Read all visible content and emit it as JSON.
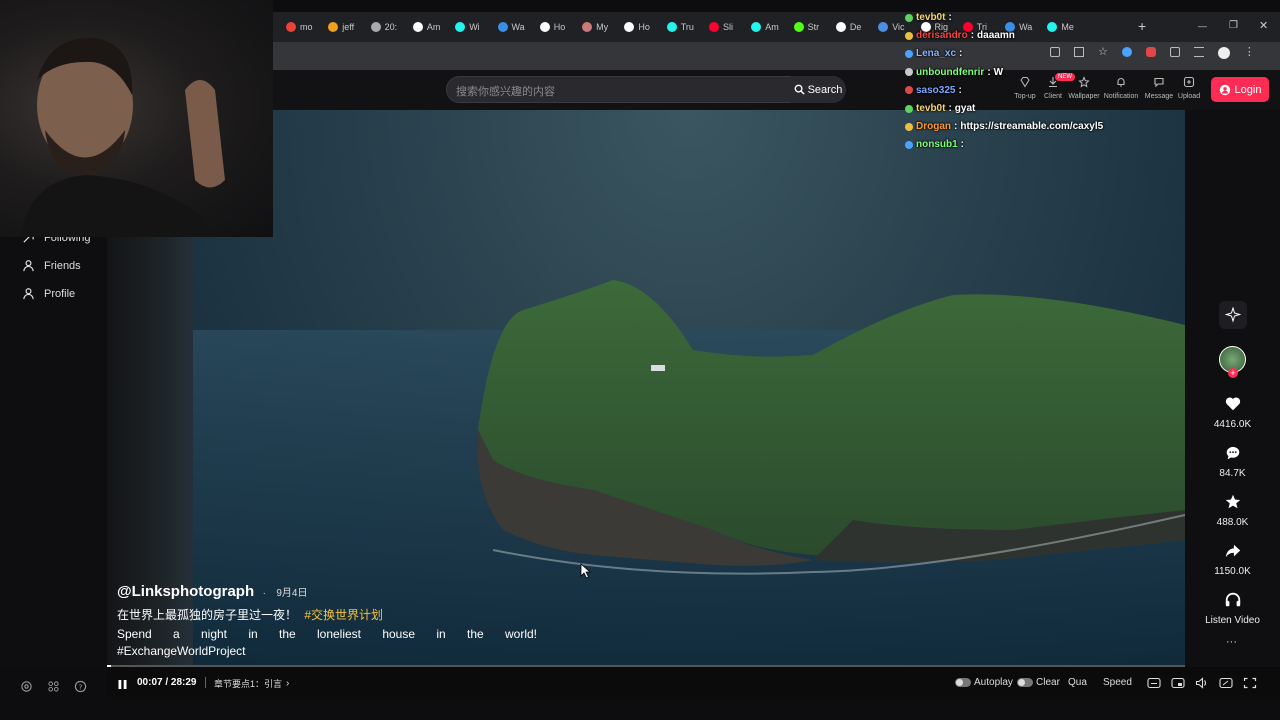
{
  "browser": {
    "tabs": [
      {
        "label": "mo",
        "color": "#ea4335"
      },
      {
        "label": "jeff",
        "color": "#f0a020"
      },
      {
        "label": "20:",
        "color": "#aaaaaa"
      },
      {
        "label": "Am",
        "color": "#ffffff"
      },
      {
        "label": "Wi",
        "color": "#25f4ee"
      },
      {
        "label": "Wa",
        "color": "#3a8ee6"
      },
      {
        "label": "Ho",
        "color": "#ffffff"
      },
      {
        "label": "My",
        "color": "#c97a7a"
      },
      {
        "label": "Ho",
        "color": "#ffffff"
      },
      {
        "label": "Tru",
        "color": "#25f4ee"
      },
      {
        "label": "Sli",
        "color": "#ff0033"
      },
      {
        "label": "Am",
        "color": "#25f4ee"
      },
      {
        "label": "Str",
        "color": "#53fc18"
      },
      {
        "label": "De",
        "color": "#ffffff"
      },
      {
        "label": "Vic",
        "color": "#4a90e2"
      },
      {
        "label": "Rig",
        "color": "#ffffff"
      },
      {
        "label": "Tri",
        "color": "#ff0033"
      },
      {
        "label": "Wa",
        "color": "#3a8ee6"
      },
      {
        "label": "Me",
        "color": "#25f4ee"
      }
    ],
    "new_tab": "+",
    "window_controls": [
      "—",
      "❐",
      "✕"
    ]
  },
  "search": {
    "placeholder": "搜索你感兴趣的内容",
    "button_label": "Search"
  },
  "top_nav": [
    {
      "label": "Top-up",
      "icon": "diamond-icon"
    },
    {
      "label": "Client",
      "icon": "download-icon",
      "badge": "NEW"
    },
    {
      "label": "Wallpaper",
      "icon": "wallpaper-icon"
    },
    {
      "label": "Notification",
      "icon": "bell-icon"
    },
    {
      "label": "Message",
      "icon": "message-icon"
    },
    {
      "label": "Upload",
      "icon": "upload-icon"
    }
  ],
  "login_label": "Login",
  "sidebar": {
    "items": [
      {
        "label": "Following",
        "icon": "following-icon"
      },
      {
        "label": "Friends",
        "icon": "friends-icon"
      },
      {
        "label": "Profile",
        "icon": "profile-icon"
      }
    ]
  },
  "video": {
    "author": "@Linksphotograph",
    "date": "9月4日",
    "caption_cn": "在世界上最孤独的房子里过一夜！",
    "hashtag_cn": "#交换世界计划",
    "caption_en": "Spend a night in the loneliest house in the world!",
    "hashtag_en": "#ExchangeWorldProject"
  },
  "actions": {
    "likes": "4416.0K",
    "comments": "84.7K",
    "favorites": "488.0K",
    "shares": "1150.0K",
    "listen": "Listen Video",
    "more": "···"
  },
  "player": {
    "time": "00:07 / 28:29",
    "progress": 0.004,
    "chapter": "章节要点1：引言",
    "autoplay": "Autoplay",
    "clear": "Clear",
    "quality": "Qua",
    "speed": "Speed"
  },
  "chat": [
    {
      "user": "tevb0t",
      "text": "",
      "color": "#f5d76e"
    },
    {
      "user": "derisandro",
      "text": "daaamn",
      "color": "#ff4040"
    },
    {
      "user": "Lena_xc",
      "text": "",
      "color": "#8ab4ff"
    },
    {
      "user": "unboundfenrir",
      "text": "W",
      "color": "#7cff7c"
    },
    {
      "user": "saso325",
      "text": "",
      "color": "#7ea8ff"
    },
    {
      "user": "tevb0t",
      "text": "gyat",
      "color": "#f5d76e"
    },
    {
      "user": "Drogan",
      "text": "https://streamable.com/caxyl5",
      "color": "#ff9a2e"
    },
    {
      "user": "nonsub1",
      "text": "",
      "color": "#7cff7c"
    }
  ]
}
